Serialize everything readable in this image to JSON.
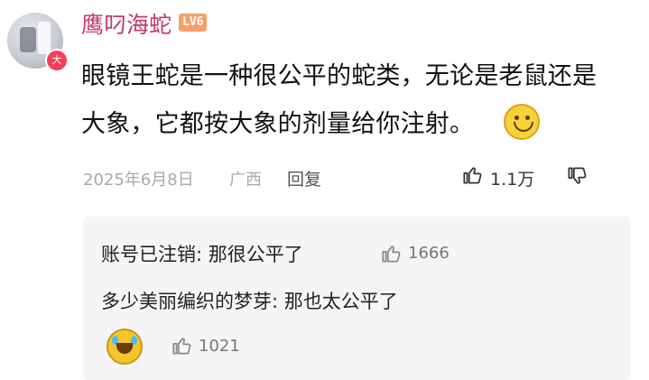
{
  "user": {
    "name": "鹰叼海蛇",
    "level": "LV6",
    "avatar_badge": "大"
  },
  "comment": {
    "line1": "眼镜王蛇是一种很公平的蛇类，无论是老鼠还是",
    "line2": "大象，它都按大象的剂量给你注射。",
    "date": "2025年6月8日",
    "region": "广西",
    "reply_label": "回复",
    "like_count": "1.1万"
  },
  "replies": [
    {
      "text": "账号已注销: 那很公平了",
      "like_count": "1666"
    },
    {
      "text": "多少美丽编织的梦芽: 那也太公平了",
      "like_count": "1021"
    }
  ],
  "colors": {
    "username": "#c2386b",
    "level_badge": "#f4a06a",
    "reply_bg": "#f5f5f5",
    "meta_text": "#aaaaaa"
  },
  "icons": [
    "thumbs-up-icon",
    "thumbs-down-icon",
    "smile-emoji-icon",
    "crying-laugh-emoji-icon"
  ]
}
